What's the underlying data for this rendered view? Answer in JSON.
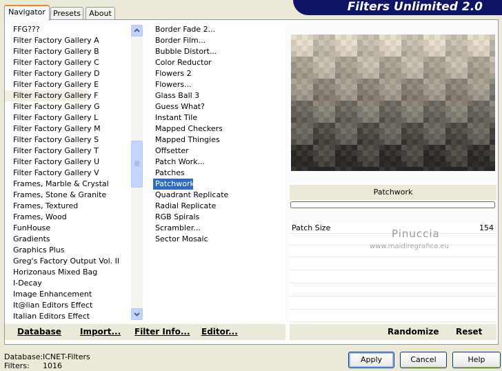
{
  "app_title": "Filters Unlimited 2.0",
  "tabs": [
    "Navigator",
    "Presets",
    "About"
  ],
  "categories": [
    "FFG???",
    "Filter Factory Gallery A",
    "Filter Factory Gallery B",
    "Filter Factory Gallery C",
    "Filter Factory Gallery D",
    "Filter Factory Gallery E",
    "Filter Factory Gallery F",
    "Filter Factory Gallery G",
    "Filter Factory Gallery L",
    "Filter Factory Gallery M",
    "Filter Factory Gallery S",
    "Filter Factory Gallery T",
    "Filter Factory Gallery U",
    "Filter Factory Gallery V",
    "Frames, Marble & Crystal",
    "Frames, Stone & Granite",
    "Frames, Textured",
    "Frames, Wood",
    "FunHouse",
    "Gradients",
    "Graphics Plus",
    "Greg's Factory Output Vol. II",
    "Horizonaus Mixed Bag",
    "I-Decay",
    "Image Enhancement",
    "It@lian Editors Effect",
    "Italian Editors Effect"
  ],
  "selected_category": "Filter Factory Gallery F",
  "filters": [
    "Border Fade 2...",
    "Border Film...",
    "Bubble Distort...",
    "Color Reductor",
    "Flowers 2",
    "Flowers...",
    "Glass Ball 3",
    "Guess What?",
    "Instant Tile",
    "Mapped Checkers",
    "Mapped Thingies",
    "Offsetter",
    "Patch Work...",
    "Patches",
    "Patchwork",
    "Quadrant Replicate",
    "Radial Replicate",
    "RGB Spirals",
    "Scrambler...",
    "Sector Mosaic"
  ],
  "selected_filter": "Patchwork",
  "toolbar": {
    "database": "Database",
    "import": "Import...",
    "filter_info": "Filter Info...",
    "editor": "Editor...",
    "randomize": "Randomize",
    "reset": "Reset"
  },
  "preview_filter_name": "Patchwork",
  "param": {
    "label": "Patch Size",
    "value": "154"
  },
  "watermark": {
    "line1": "Pinuccia",
    "line2": "www.maidiregrafica.eu"
  },
  "status": {
    "database_label": "Database:",
    "database_value": "ICNET-Filters",
    "filters_label": "Filters:",
    "filters_value": "1016"
  },
  "buttons": {
    "apply": "Apply",
    "cancel": "Cancel",
    "help": "Help"
  },
  "colors": {
    "banner": "#0f1464",
    "selection": "#316ac5",
    "tab_accent": "#e68b2c"
  }
}
